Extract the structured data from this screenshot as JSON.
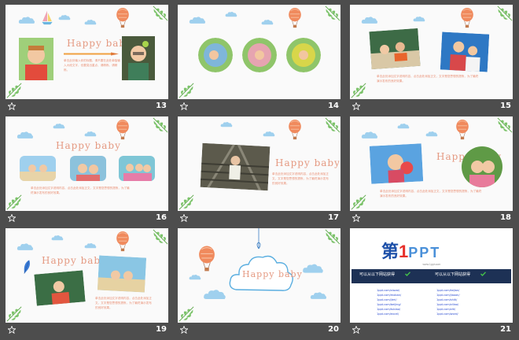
{
  "slides": [
    {
      "number": "13",
      "title": "Happy baby",
      "text": "单击此处输入你的标题、请不要在此处单独输入大段文字，也要突出重点、请精炼。请精炼。"
    },
    {
      "number": "14"
    },
    {
      "number": "15",
      "text": "单击此处添加文字说明内容，点击此处添加正文，文字是您思想的提炼，为了最终演示发布的良好效果。"
    },
    {
      "number": "16",
      "title": "Happy baby",
      "text": "单击此处添加文字说明内容，点击此处添加正文，文字是您思想的提炼，为了最终演示发布的良好效果。"
    },
    {
      "number": "17",
      "title": "Happy baby",
      "text": "单击此处添加文字说明内容，点击此处添加正文，文字是您思想的提炼，为了最终演示发布的良好效果。"
    },
    {
      "number": "18",
      "title": "Happy baby",
      "text": "单击此处添加文字说明内容，点击此处添加正文，文字是您思想的提炼，为了最终演示发布的良好效果。"
    },
    {
      "number": "19",
      "title": "Happy baby",
      "text": "单击此处添加文字说明内容，点击此处添加正文，文字是您思想的提炼，为了最终演示发布的良好效果。"
    },
    {
      "number": "20",
      "title": "Happy baby"
    },
    {
      "number": "21",
      "logo_main": "第",
      "logo_num": "1",
      "logo_ppt": "PPT",
      "logo_sub": "www.1ppt.com",
      "bar_left": "可以从以下网站获得",
      "bar_right": "可以从以下网站获得",
      "links_left": [
        "1ppt.com/xiazai/",
        "1ppt.com/moban/",
        "1ppt.com/jieri/",
        "1ppt.com/beijing/",
        "1ppt.com/tubiao/",
        "1ppt.com/excel/"
      ],
      "links_right": [
        "1ppt.com/kejian/",
        "1ppt.com/jiaoan/",
        "1ppt.com/shiti/",
        "1ppt.com/ziliao/",
        "1ppt.com/ziti/",
        "1ppt.com/word/"
      ]
    }
  ],
  "colors": {
    "background": "#4d4d4d",
    "slide": "#fafafa",
    "title": "#e59a82",
    "cloud": "#8fc7e8",
    "leaf": "#7cc36a",
    "balloon": "#f08a5d"
  }
}
